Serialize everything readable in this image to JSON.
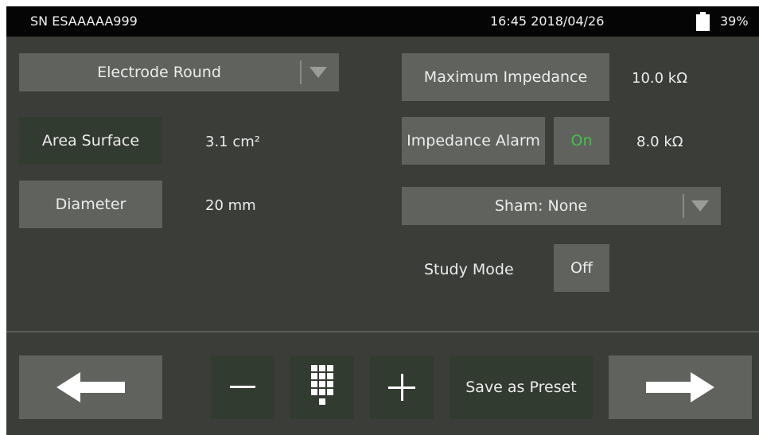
{
  "status": {
    "serial": "SN ESAAAAA999",
    "datetime": "16:45 2018/04/26",
    "battery": "39%"
  },
  "electrode": {
    "type_selected": "Electrode Round",
    "area_label": "Area Surface",
    "area_value": "3.1 cm²",
    "diameter_label": "Diameter",
    "diameter_value": "20 mm"
  },
  "impedance": {
    "max_label": "Maximum Impedance",
    "max_value": "10.0 kΩ",
    "alarm_label": "Impedance Alarm",
    "alarm_state": "On",
    "alarm_value": "8.0 kΩ"
  },
  "sham": {
    "selected": "Sham: None"
  },
  "study": {
    "label": "Study Mode",
    "state": "Off"
  },
  "bottom": {
    "save_label": "Save as Preset"
  },
  "colors": {
    "on_green": "#3ec34a",
    "button_gray": "#60635d",
    "button_dark": "#323b30",
    "background": "#3a3d38"
  },
  "icons": [
    "battery-icon",
    "chevron-down-icon",
    "arrow-left-icon",
    "minus-icon",
    "keypad-icon",
    "plus-icon",
    "arrow-right-icon"
  ]
}
